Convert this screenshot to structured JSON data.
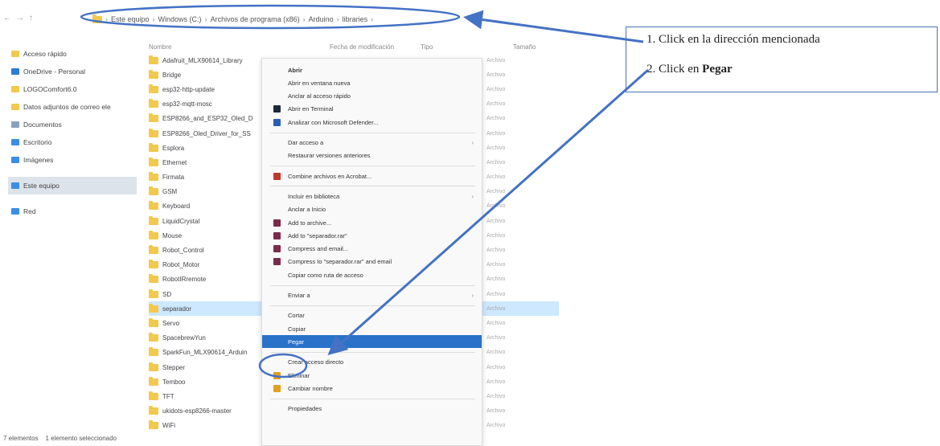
{
  "nav": {
    "back": "←",
    "forward": "→",
    "up": "↑"
  },
  "breadcrumb": [
    "Este equipo",
    "Windows (C:)",
    "Archivos de programa (x86)",
    "Arduino",
    "libraries"
  ],
  "sidebar": {
    "items": [
      {
        "label": "Acceso rápido",
        "color": "#f2c94c"
      },
      {
        "label": "OneDrive - Personal",
        "color": "#2b7cd3"
      },
      {
        "label": "LOGOComfort6.0",
        "color": "#f2c94c"
      },
      {
        "label": "Datos adjuntos de correo ele",
        "color": "#f2c94c"
      },
      {
        "label": "Documentos",
        "color": "#8aa0c0"
      },
      {
        "label": "Escritorio",
        "color": "#3a8ee6"
      },
      {
        "label": "Imágenes",
        "color": "#3a8ee6"
      },
      {
        "label": "Este equipo",
        "color": "#3a8ee6"
      },
      {
        "label": "Red",
        "color": "#3a8ee6"
      }
    ]
  },
  "columns": {
    "name": "Nombre",
    "date": "Fecha de modificación",
    "type": "Tipo",
    "size": "Tamaño"
  },
  "files": [
    {
      "name": "Adafruit_MLX90614_Library"
    },
    {
      "name": "Bridge"
    },
    {
      "name": "esp32-http-update"
    },
    {
      "name": "esp32-mqtt-mosc"
    },
    {
      "name": "ESP8266_and_ESP32_Oled_D"
    },
    {
      "name": "ESP8266_Oled_Driver_for_SS"
    },
    {
      "name": "Esplora"
    },
    {
      "name": "Ethernet"
    },
    {
      "name": "Firmata"
    },
    {
      "name": "GSM"
    },
    {
      "name": "Keyboard"
    },
    {
      "name": "LiquidCrystal"
    },
    {
      "name": "Mouse"
    },
    {
      "name": "Robot_Control"
    },
    {
      "name": "Robot_Motor"
    },
    {
      "name": "RobotIRremote"
    },
    {
      "name": "SD"
    },
    {
      "name": "separador"
    },
    {
      "name": "Servo"
    },
    {
      "name": "SpacebrewYun"
    },
    {
      "name": "SparkFun_MLX90614_Arduin"
    },
    {
      "name": "Stepper"
    },
    {
      "name": "Temboo"
    },
    {
      "name": "TFT"
    },
    {
      "name": "ukidots-esp8266-master"
    },
    {
      "name": "WiFi"
    }
  ],
  "file_type": "Archivo",
  "context_menu": [
    {
      "label": "Abrir",
      "bold": true
    },
    {
      "label": "Abrir en ventana nueva"
    },
    {
      "label": "Anclar al acceso rápido"
    },
    {
      "label": "Abrir en Terminal",
      "icon": "#1e2a3a"
    },
    {
      "label": "Analizar con Microsoft Defender...",
      "icon": "#2b5fb4"
    },
    {
      "divider": true
    },
    {
      "label": "Dar acceso a",
      "sub": true
    },
    {
      "label": "Restaurar versiones anteriores"
    },
    {
      "divider": true
    },
    {
      "label": "Combine archivos en Acrobat...",
      "icon": "#c0392b"
    },
    {
      "divider": true
    },
    {
      "label": "Incluir en biblioteca",
      "sub": true
    },
    {
      "label": "Anclar a Inicio"
    },
    {
      "label": "Add to archive...",
      "icon": "#7a2a4a"
    },
    {
      "label": "Add to \"separador.rar\"",
      "icon": "#7a2a4a"
    },
    {
      "label": "Compress and email...",
      "icon": "#7a2a4a"
    },
    {
      "label": "Compress to \"separador.rar\" and email",
      "icon": "#7a2a4a"
    },
    {
      "label": "Copiar como ruta de acceso"
    },
    {
      "divider": true
    },
    {
      "label": "Enviar a",
      "sub": true
    },
    {
      "divider": true
    },
    {
      "label": "Cortar"
    },
    {
      "label": "Copiar"
    },
    {
      "label": "Pegar",
      "highlight": true
    },
    {
      "divider": true
    },
    {
      "label": "Crear acceso directo"
    },
    {
      "label": "Eliminar",
      "icon": "#e0a020"
    },
    {
      "label": "Cambiar nombre",
      "icon": "#e0a020"
    },
    {
      "divider": true
    },
    {
      "label": "Propiedades"
    }
  ],
  "status": {
    "count": "7 elementos",
    "selected": "1 elemento seleccionado"
  },
  "callout": {
    "line1": "1. Click en la dirección mencionada",
    "line2_prefix": "2. Click en ",
    "line2_bold": "Pegar"
  },
  "colors": {
    "annotation": "#4472c4",
    "highlight": "#2a72c8",
    "selection": "#cde8ff",
    "folder": "#f2c94c"
  }
}
